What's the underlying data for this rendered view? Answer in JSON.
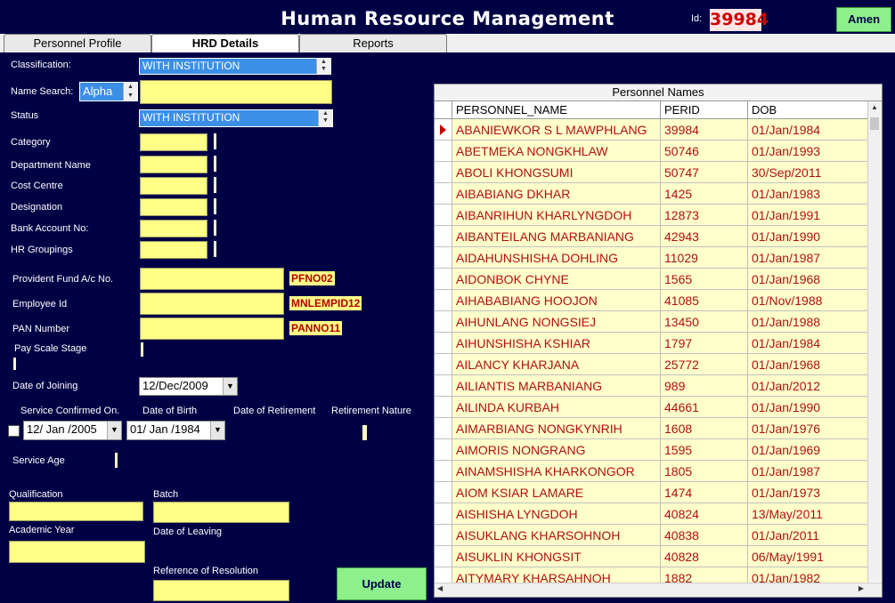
{
  "header": {
    "title": "Human Resource Management",
    "id_label": "Id:",
    "id_value": "39984",
    "user_button": "Amen"
  },
  "tabs": [
    {
      "label": "Personnel Profile"
    },
    {
      "label": "HRD Details"
    },
    {
      "label": "Reports"
    }
  ],
  "form": {
    "classification_label": "Classification:",
    "classification_value": "WITH INSTITUTION",
    "name_search_label": "Name Search:",
    "name_search_mode": "Alpha",
    "name_search_value": "",
    "status_label": "Status",
    "status_value": "WITH INSTITUTION",
    "category_label": "Category",
    "department_label": "Department Name",
    "cost_centre_label": "Cost Centre",
    "designation_label": "Designation",
    "bank_account_label": "Bank Account No:",
    "hr_groupings_label": "HR Groupings",
    "pf_label": "Provident Fund A/c No.",
    "pf_tag": "PFNO02",
    "employee_id_label": "Employee Id",
    "employee_id_tag": "MNLEMPID12",
    "pan_label": "PAN Number",
    "pan_tag": "PANNO11",
    "pay_scale_label": "Pay Scale Stage",
    "doj_label": "Date of Joining",
    "doj_value": "12/Dec/2009",
    "service_confirmed_label": "Service Confirmed On.",
    "service_confirmed_value": "12/ Jan /2005",
    "dob_label": "Date of Birth",
    "dob_value": "01/ Jan /1984",
    "retirement_date_label": "Date of Retirement",
    "retirement_nature_label": "Retirement Nature",
    "service_age_label": "Service Age",
    "qualification_label": "Qualification",
    "batch_label": "Batch",
    "academic_year_label": "Academic Year",
    "date_leaving_label": "Date of Leaving",
    "resolution_label": "Reference of Resolution",
    "update_button": "Update"
  },
  "grid": {
    "title": "Personnel Names",
    "columns": [
      "PERSONNEL_NAME",
      "PERID",
      "DOB"
    ],
    "rows": [
      [
        "ABANIEWKOR S L MAWPHLANG",
        "39984",
        "01/Jan/1984"
      ],
      [
        "ABETMEKA NONGKHLAW",
        "50746",
        "01/Jan/1993"
      ],
      [
        "ABOLI KHONGSUMI",
        "50747",
        "30/Sep/2011"
      ],
      [
        "AIBABIANG DKHAR",
        "1425",
        "01/Jan/1983"
      ],
      [
        "AIBANRIHUN KHARLYNGDOH",
        "12873",
        "01/Jan/1991"
      ],
      [
        "AIBANTEILANG MARBANIANG",
        "42943",
        "01/Jan/1990"
      ],
      [
        "AIDAHUNSHISHA DOHLING",
        "11029",
        "01/Jan/1987"
      ],
      [
        "AIDONBOK CHYNE",
        "1565",
        "01/Jan/1968"
      ],
      [
        "AIHABABIANG HOOJON",
        "41085",
        "01/Nov/1988"
      ],
      [
        "AIHUNLANG NONGSIEJ",
        "13450",
        "01/Jan/1988"
      ],
      [
        "AIHUNSHISHA KSHIAR",
        "1797",
        "01/Jan/1984"
      ],
      [
        "AILANCY KHARJANA",
        "25772",
        "01/Jan/1968"
      ],
      [
        "AILIANTIS MARBANIANG",
        "989",
        "01/Jan/2012"
      ],
      [
        "AILINDA KURBAH",
        "44661",
        "01/Jan/1990"
      ],
      [
        "AIMARBIANG NONGKYNRIH",
        "1608",
        "01/Jan/1976"
      ],
      [
        "AIMORIS NONGRANG",
        "1595",
        "01/Jan/1969"
      ],
      [
        "AINAMSHISHA KHARKONGOR",
        "1805",
        "01/Jan/1987"
      ],
      [
        "AIOM KSIAR LAMARE",
        "1474",
        "01/Jan/1973"
      ],
      [
        "AISHISHA LYNGDOH",
        "40824",
        "13/May/2011"
      ],
      [
        "AISUKLANG KHARSOHNOH",
        "40838",
        "01/Jan/2011"
      ],
      [
        "AISUKLIN KHONGSIT",
        "40828",
        "06/May/1991"
      ],
      [
        "AITYMARY KHARSAHNOH",
        "1882",
        "01/Jan/1982"
      ]
    ]
  },
  "colors": {
    "background": "#000045",
    "field_yellow": "#ffff88",
    "accent_red": "#b40000",
    "combo_blue": "#3b8fe6",
    "button_green": "#8df08d"
  },
  "icons": {
    "row_pointer": "triangle-right",
    "spin": "up-down-arrows",
    "dropdown": "triangle-down"
  }
}
